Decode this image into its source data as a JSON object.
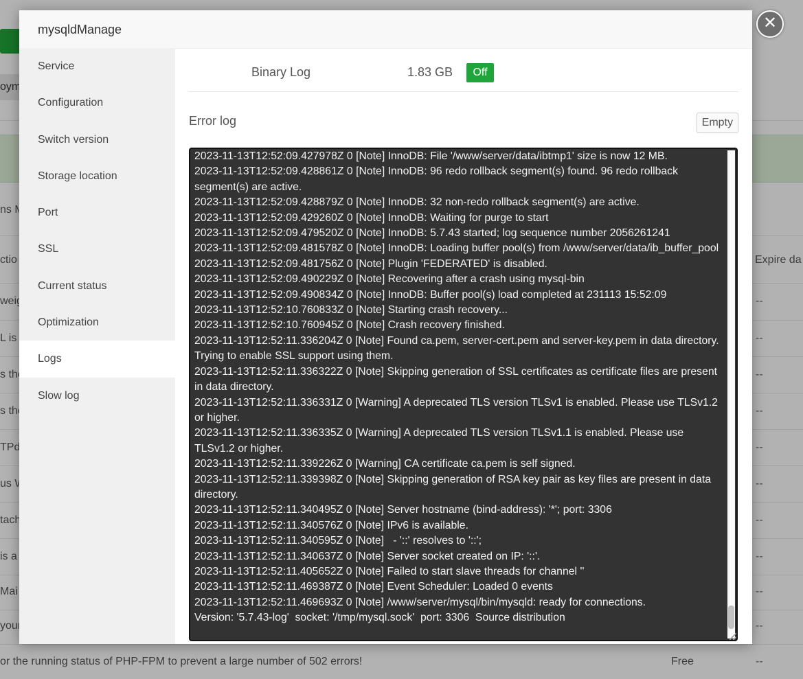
{
  "background": {
    "tab_fragment": "oym",
    "row_fragments": [
      "ns M",
      "ctio",
      "weig",
      "L is",
      "s the",
      "s the",
      "TPd",
      "us W",
      "tach",
      "is a",
      "Mai",
      "your"
    ],
    "expire_header": "Expire da",
    "dash": "--",
    "bottom_text": "or the running status of PHP-FPM to prevent a large number of 502 errors!",
    "bottom_free": "Free"
  },
  "modal": {
    "title": "mysqldManage",
    "close_icon": "close-icon",
    "sidebar": {
      "items": [
        {
          "label": "Service",
          "active": false
        },
        {
          "label": "Configuration",
          "active": false
        },
        {
          "label": "Switch version",
          "active": false
        },
        {
          "label": "Storage location",
          "active": false
        },
        {
          "label": "Port",
          "active": false
        },
        {
          "label": "SSL",
          "active": false
        },
        {
          "label": "Current status",
          "active": false
        },
        {
          "label": "Optimization",
          "active": false
        },
        {
          "label": "Logs",
          "active": true
        },
        {
          "label": "Slow log",
          "active": false
        }
      ]
    },
    "binary_log": {
      "label": "Binary Log",
      "size": "1.83 GB",
      "status": "Off"
    },
    "error_log": {
      "title": "Error log",
      "empty_label": "Empty",
      "content": "2023-11-13T12:52:09.427978Z 0 [Note] InnoDB: File '/www/server/data/ibtmp1' size is now 12 MB.\n2023-11-13T12:52:09.428861Z 0 [Note] InnoDB: 96 redo rollback segment(s) found. 96 redo rollback segment(s) are active.\n2023-11-13T12:52:09.428879Z 0 [Note] InnoDB: 32 non-redo rollback segment(s) are active.\n2023-11-13T12:52:09.429260Z 0 [Note] InnoDB: Waiting for purge to start\n2023-11-13T12:52:09.479520Z 0 [Note] InnoDB: 5.7.43 started; log sequence number 2056261241\n2023-11-13T12:52:09.481578Z 0 [Note] InnoDB: Loading buffer pool(s) from /www/server/data/ib_buffer_pool\n2023-11-13T12:52:09.481756Z 0 [Note] Plugin 'FEDERATED' is disabled.\n2023-11-13T12:52:09.490229Z 0 [Note] Recovering after a crash using mysql-bin\n2023-11-13T12:52:09.490834Z 0 [Note] InnoDB: Buffer pool(s) load completed at 231113 15:52:09\n2023-11-13T12:52:10.760833Z 0 [Note] Starting crash recovery...\n2023-11-13T12:52:10.760945Z 0 [Note] Crash recovery finished.\n2023-11-13T12:52:11.336204Z 0 [Note] Found ca.pem, server-cert.pem and server-key.pem in data directory. Trying to enable SSL support using them.\n2023-11-13T12:52:11.336322Z 0 [Note] Skipping generation of SSL certificates as certificate files are present in data directory.\n2023-11-13T12:52:11.336331Z 0 [Warning] A deprecated TLS version TLSv1 is enabled. Please use TLSv1.2 or higher.\n2023-11-13T12:52:11.336335Z 0 [Warning] A deprecated TLS version TLSv1.1 is enabled. Please use TLSv1.2 or higher.\n2023-11-13T12:52:11.339226Z 0 [Warning] CA certificate ca.pem is self signed.\n2023-11-13T12:52:11.339398Z 0 [Note] Skipping generation of RSA key pair as key files are present in data directory.\n2023-11-13T12:52:11.340495Z 0 [Note] Server hostname (bind-address): '*'; port: 3306\n2023-11-13T12:52:11.340576Z 0 [Note] IPv6 is available.\n2023-11-13T12:52:11.340595Z 0 [Note]   - '::' resolves to '::';\n2023-11-13T12:52:11.340637Z 0 [Note] Server socket created on IP: '::'.\n2023-11-13T12:52:11.405652Z 0 [Note] Failed to start slave threads for channel ''\n2023-11-13T12:52:11.469387Z 0 [Note] Event Scheduler: Loaded 0 events\n2023-11-13T12:52:11.469693Z 0 [Note] /www/server/mysql/bin/mysqld: ready for connections.\nVersion: '5.7.43-log'  socket: '/tmp/mysql.sock'  port: 3306  Source distribution"
    }
  },
  "colors": {
    "accent_green": "#20a53a",
    "log_background": "#333333",
    "log_text": "#f2f2f2"
  }
}
